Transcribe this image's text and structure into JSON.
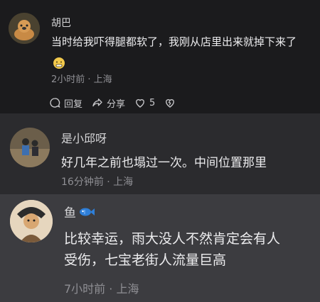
{
  "comments": [
    {
      "name": "胡巴",
      "text": "当时给我吓得腿都软了，我刚从店里出来就掉下来了",
      "meta": "2小时前 · 上海",
      "actions": {
        "reply": "回复",
        "share": "分享",
        "likes": "5"
      },
      "icons": [
        "reply-icon",
        "share-icon",
        "like-icon",
        "dislike-icon"
      ]
    },
    {
      "name": "是小邱呀",
      "text": "好几年之前也塌过一次。中间位置那里",
      "meta": "16分钟前 · 上海"
    },
    {
      "name": "鱼",
      "text_lines": [
        "比较幸运，雨大没人不然肯定会有人",
        "受伤，七宝老街人流量巨高"
      ],
      "meta": "7小时前 · 上海"
    }
  ],
  "colors": {
    "bg_top": "#1b1b1d",
    "bg_mid": "#2b2b2e",
    "bg_bottom": "#3c3c40",
    "meta": "#8f8f94",
    "fish": "#2f7fd8"
  }
}
